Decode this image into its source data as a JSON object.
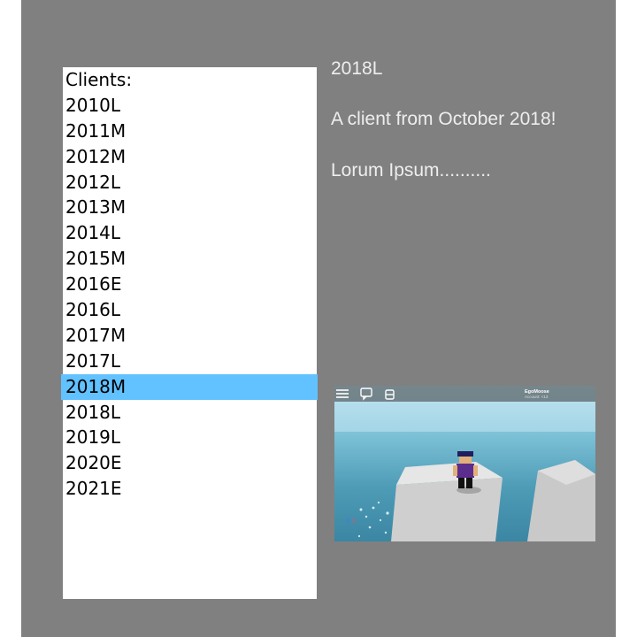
{
  "client_list": {
    "header": "Clients:",
    "items": [
      "2010L",
      "2011M",
      "2012M",
      "2012L",
      "2013M",
      "2014L",
      "2015M",
      "2016E",
      "2016L",
      "2017M",
      "2017L",
      "2018M",
      "2018L",
      "2019L",
      "2020E",
      "2021E"
    ],
    "selected": "2018M"
  },
  "details": {
    "title": "2018L",
    "description": "A client from October 2018!",
    "body": "Lorum Ipsum.........."
  },
  "preview": {
    "username": "EgoMoose",
    "account_label": "Account: <13",
    "icons": [
      "menu-icon",
      "chat-icon",
      "backpack-icon"
    ]
  },
  "colors": {
    "window_bg": "#808080",
    "selection": "#62c1ff",
    "detail_text": "#eeeeee"
  }
}
